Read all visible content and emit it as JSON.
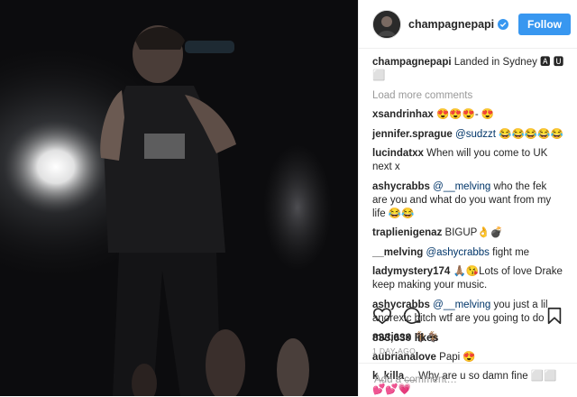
{
  "post": {
    "author": "champagnepapi",
    "follow_label": "Follow",
    "caption": {
      "user": "champagnepapi",
      "text": "Landed in Sydney 🅰 🆄 ⬜"
    },
    "load_more": "Load more comments",
    "comments": [
      {
        "user": "xsandrinhax",
        "text": "😍😍😍- 😍"
      },
      {
        "user": "jennifer.sprague",
        "mention": "@sudzzt",
        "text": "😂😂😂😂😂"
      },
      {
        "user": "lucindatxx",
        "text": "When will you come to UK next x"
      },
      {
        "user": "ashycrabbs",
        "mention": "@__melving",
        "text": "who the fek are you and what do you want from my life 😂😂"
      },
      {
        "user": "traplienigenaz",
        "text": "BIGUP👌💣"
      },
      {
        "user": "__melving",
        "mention": "@ashycrabbs",
        "text": "fight me"
      },
      {
        "user": "ladymystery174",
        "text": "🙏🏽😘Lots of love Drake keep making your music."
      },
      {
        "user": "ashycrabbs",
        "mention": "@__melving",
        "text": "you just a lil anorexic bitch wtf are you going to do"
      },
      {
        "user": "mvtiasx",
        "text": "🐐🐐"
      },
      {
        "user": "aubrianalove",
        "text": "Papi 😍"
      },
      {
        "user": "k_killa__",
        "text": "Why are u so damn fine ⬜⬜💕💕💗"
      }
    ],
    "likes": "833,630 likes",
    "time_ago": "1 DAY AGO",
    "add_comment_placeholder": "Add a comment…"
  },
  "colors": {
    "accent": "#3897f0",
    "mention": "#003569",
    "muted": "#999999",
    "text": "#262626"
  },
  "icons": [
    "verified-badge-icon",
    "heart-icon",
    "comment-icon",
    "bookmark-icon"
  ]
}
